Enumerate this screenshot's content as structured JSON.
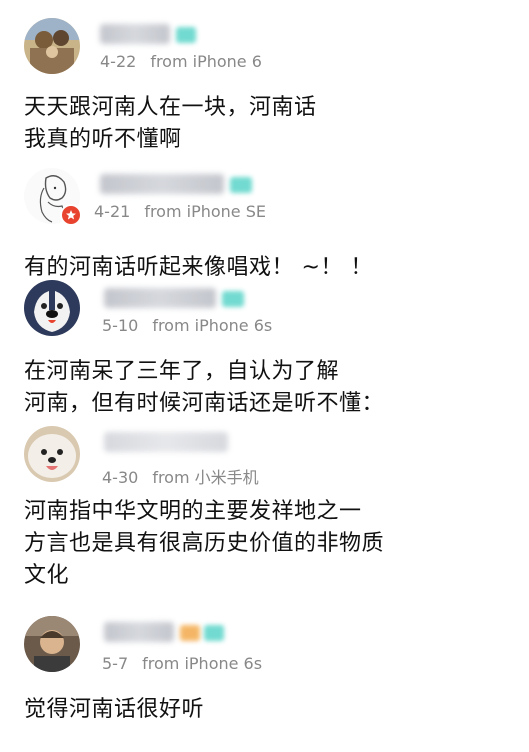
{
  "comments": [
    {
      "date": "4-22",
      "source": "from iPhone 6",
      "lines": [
        "天天跟河南人在一块，河南话",
        "我真的听不懂啊"
      ]
    },
    {
      "date": "4-21",
      "source": "from iPhone SE",
      "lines": [
        "有的河南话听起来像唱戏！ ~！ ！"
      ]
    },
    {
      "date": "5-10",
      "source": "from iPhone 6s",
      "lines": [
        "在河南呆了三年了，自认为了解",
        "河南，但有时候河南话还是听不懂："
      ]
    },
    {
      "date": "4-30",
      "source": "from 小米手机",
      "lines": [
        "河南指中华文明的主要发祥地之一",
        "方言也是具有很高历史价值的非物质",
        "文化"
      ]
    },
    {
      "date": "5-7",
      "source": "from iPhone 6s",
      "lines": [
        "觉得河南话很好听"
      ]
    }
  ],
  "colors": {
    "meta": "#888888",
    "text": "#111111",
    "vip_teal": "#4fd1c5",
    "vip_orange": "#f2a541",
    "badge_red": "#e8432f"
  },
  "icons": [
    "avatar-photo",
    "avatar-sketch",
    "avatar-dog-cartoon",
    "avatar-samoyed",
    "avatar-man"
  ]
}
